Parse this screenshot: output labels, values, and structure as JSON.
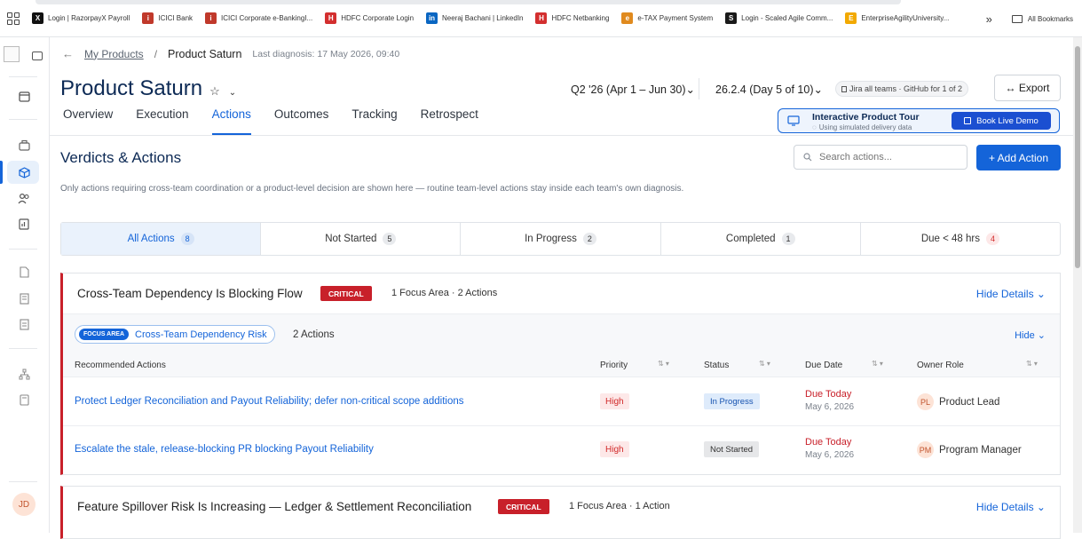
{
  "bookmarks": {
    "items": [
      {
        "label": "Login | RazorpayX Payroll",
        "icon": "x-logo-icon",
        "color": "#111111",
        "glyph": "X"
      },
      {
        "label": "ICICI Bank",
        "icon": "icici-logo-icon",
        "color": "#c0392b",
        "glyph": "i"
      },
      {
        "label": "ICICI Corporate e-BankingI...",
        "icon": "icici-logo-icon",
        "color": "#c0392b",
        "glyph": "i"
      },
      {
        "label": "HDFC Corporate  Login",
        "icon": "hdfc-logo-icon",
        "color": "#d32f2f",
        "glyph": "H"
      },
      {
        "label": "Neeraj Bachani | LinkedIn",
        "icon": "linkedin-icon",
        "color": "#0a66c2",
        "glyph": "in"
      },
      {
        "label": "HDFC Netbanking",
        "icon": "hdfc-logo-icon",
        "color": "#d32f2f",
        "glyph": "H"
      },
      {
        "label": "e-TAX Payment System",
        "icon": "etax-logo-icon",
        "color": "#e08a1e",
        "glyph": "e"
      },
      {
        "label": "Login - Scaled Agile Comm...",
        "icon": "scaled-agile-icon",
        "color": "#1a1a1a",
        "glyph": "S"
      },
      {
        "label": "EnterpriseAgilityUniversity...",
        "icon": "eau-logo-icon",
        "color": "#f2a900",
        "glyph": "E"
      }
    ],
    "more": "»",
    "all_bookmarks": "All Bookmarks"
  },
  "sidebar": {
    "avatar": "JD"
  },
  "breadcrumb": {
    "back": "←",
    "parent": "My Products",
    "separator": "/",
    "current": "Product Saturn",
    "last_diagnosis": "Last diagnosis: 17 May 2026, 09:40"
  },
  "header": {
    "title": "Product Saturn",
    "star": "☆",
    "caret": "⌄",
    "quarter": "Q2 '26 (Apr 1 – Jun 30)⌄",
    "release": "26.2.4 (Day 5 of 10)⌄",
    "integration": "Jira all teams · GitHub for 1 of 2",
    "export": "↔ Export"
  },
  "tabs": [
    {
      "label": "Overview"
    },
    {
      "label": "Execution"
    },
    {
      "label": "Actions",
      "active": true
    },
    {
      "label": "Outcomes"
    },
    {
      "label": "Tracking"
    },
    {
      "label": "Retrospect"
    }
  ],
  "tour": {
    "title": "Interactive Product Tour",
    "subtitle": "Using simulated delivery data",
    "demo": "Book Live Demo"
  },
  "section": {
    "title": "Verdicts & Actions",
    "search_placeholder": "Search actions...",
    "add_action": "+ Add Action",
    "subtext": "Only actions requiring cross-team coordination or a product-level decision are shown here — routine team-level actions stay inside each team's own diagnosis."
  },
  "filters": [
    {
      "label": "All Actions",
      "count": "8",
      "active": true
    },
    {
      "label": "Not Started",
      "count": "5"
    },
    {
      "label": "In Progress",
      "count": "2"
    },
    {
      "label": "Completed",
      "count": "1"
    },
    {
      "label": "Due < 48 hrs",
      "count": "4",
      "alert": true
    }
  ],
  "cards": [
    {
      "title": "Cross-Team Dependency Is Blocking Flow",
      "severity": "CRITICAL",
      "meta": "1 Focus Area · 2 Actions",
      "toggle": "Hide Details ⌄",
      "focus_area": {
        "badge": "FOCUS AREA",
        "name": "Cross-Team Dependency Risk",
        "count": "2 Actions",
        "toggle": "Hide ⌄"
      },
      "columns": {
        "action": "Recommended Actions",
        "priority": "Priority",
        "status": "Status",
        "due": "Due Date",
        "owner": "Owner Role",
        "sort_glyph": "⇅ ▾"
      },
      "rows": [
        {
          "action": "Protect Ledger Reconciliation and Payout Reliability; defer non-critical scope additions",
          "priority": "High",
          "status": "In Progress",
          "due_label": "Due Today",
          "due_date": "May 6, 2026",
          "owner_initials": "PL",
          "owner": "Product Lead"
        },
        {
          "action": "Escalate the stale, release-blocking PR blocking Payout Reliability",
          "priority": "High",
          "status": "Not Started",
          "due_label": "Due Today",
          "due_date": "May 6, 2026",
          "owner_initials": "PM",
          "owner": "Program Manager"
        }
      ]
    },
    {
      "title": "Feature Spillover Risk Is Increasing — Ledger & Settlement Reconciliation",
      "severity": "CRITICAL",
      "meta": "1 Focus Area · 1 Action",
      "toggle": "Hide Details ⌄"
    }
  ],
  "colors": {
    "accent": "#1464d9",
    "navy": "#0d2a55",
    "critical": "#c8202a"
  }
}
